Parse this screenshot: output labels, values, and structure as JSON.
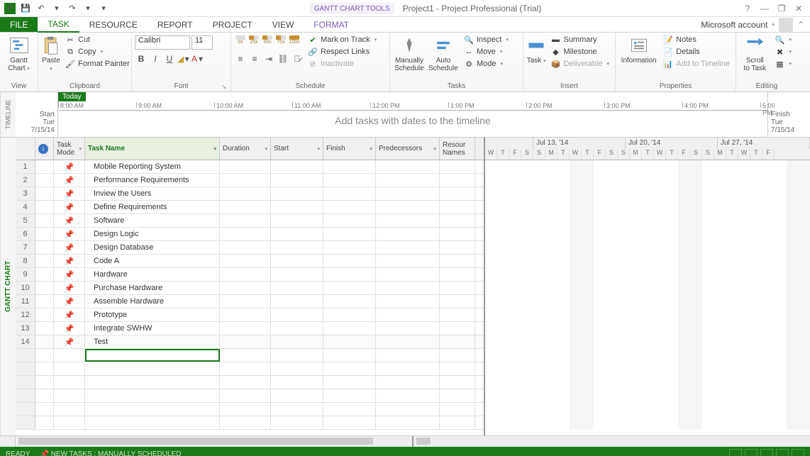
{
  "titlebar": {
    "context_tool": "GANTT CHART TOOLS",
    "project_title": "Project1 - Project Professional (Trial)"
  },
  "tabs": {
    "file": "FILE",
    "task": "TASK",
    "resource": "RESOURCE",
    "report": "REPORT",
    "project": "PROJECT",
    "view": "VIEW",
    "format": "FORMAT",
    "account": "Microsoft account"
  },
  "ribbon": {
    "views": {
      "label": "View",
      "gantt": "Gantt\nChart"
    },
    "clipboard": {
      "label": "Clipboard",
      "paste": "Paste",
      "cut": "Cut",
      "copy": "Copy",
      "fp": "Format Painter"
    },
    "font": {
      "label": "Font",
      "name": "Calibri",
      "size": "11"
    },
    "schedule": {
      "label": "Schedule",
      "mot": "Mark on Track",
      "rl": "Respect Links",
      "inact": "Inactivate"
    },
    "tasks": {
      "label": "Tasks",
      "man": "Manually\nSchedule",
      "auto": "Auto\nSchedule",
      "inspect": "Inspect",
      "move": "Move",
      "mode": "Mode"
    },
    "insert": {
      "label": "Insert",
      "task": "Task",
      "summary": "Summary",
      "milestone": "Milestone",
      "deliv": "Deliverable"
    },
    "properties": {
      "label": "Properties",
      "info": "Information",
      "notes": "Notes",
      "details": "Details",
      "att": "Add to Timeline"
    },
    "editing": {
      "label": "Editing",
      "scroll": "Scroll\nto Task"
    }
  },
  "timeline": {
    "label": "TIMELINE",
    "today": "Today",
    "start_lbl": "Start",
    "start_date": "Tue 7/15/14",
    "finish_lbl": "Finish",
    "finish_date": "Tue 7/15/14",
    "hint": "Add tasks with dates to the timeline",
    "ticks": [
      "8:00 AM",
      "9:00 AM",
      "10:00 AM",
      "11:00 AM",
      "12:00 PM",
      "1:00 PM",
      "2:00 PM",
      "3:00 PM",
      "4:00 PM",
      "5:00 PM"
    ]
  },
  "sheet": {
    "vlabel": "GANTT CHART",
    "columns": {
      "mode": "Task\nMode",
      "name": "Task Name",
      "dur": "Duration",
      "start": "Start",
      "fin": "Finish",
      "pred": "Predecessors",
      "res": "Resour\nNames"
    },
    "rows": [
      {
        "n": "1",
        "name": "Mobile Reporting System"
      },
      {
        "n": "2",
        "name": "Performance Requirements"
      },
      {
        "n": "3",
        "name": "Inview the Users"
      },
      {
        "n": "4",
        "name": "Define Requirements"
      },
      {
        "n": "5",
        "name": "Software"
      },
      {
        "n": "6",
        "name": "Design Logic"
      },
      {
        "n": "7",
        "name": "Design Database"
      },
      {
        "n": "8",
        "name": "Code A"
      },
      {
        "n": "9",
        "name": "Hardware"
      },
      {
        "n": "10",
        "name": "Purchase Hardware"
      },
      {
        "n": "11",
        "name": "Assemble Hardware"
      },
      {
        "n": "12",
        "name": "Prototype"
      },
      {
        "n": "13",
        "name": "Integrate SWHW"
      },
      {
        "n": "14",
        "name": "Test"
      }
    ]
  },
  "gantt": {
    "weeks": [
      "Jul 13, '14",
      "Jul 20, '14",
      "Jul 27, '14"
    ],
    "days": [
      "W",
      "T",
      "F",
      "S",
      "S",
      "M",
      "T",
      "W",
      "T",
      "F",
      "S",
      "S",
      "M",
      "T",
      "W",
      "T",
      "F",
      "S",
      "S",
      "M",
      "T",
      "W",
      "T",
      "F"
    ]
  },
  "status": {
    "ready": "READY",
    "hint": "NEW TASKS : MANUALLY SCHEDULED"
  }
}
